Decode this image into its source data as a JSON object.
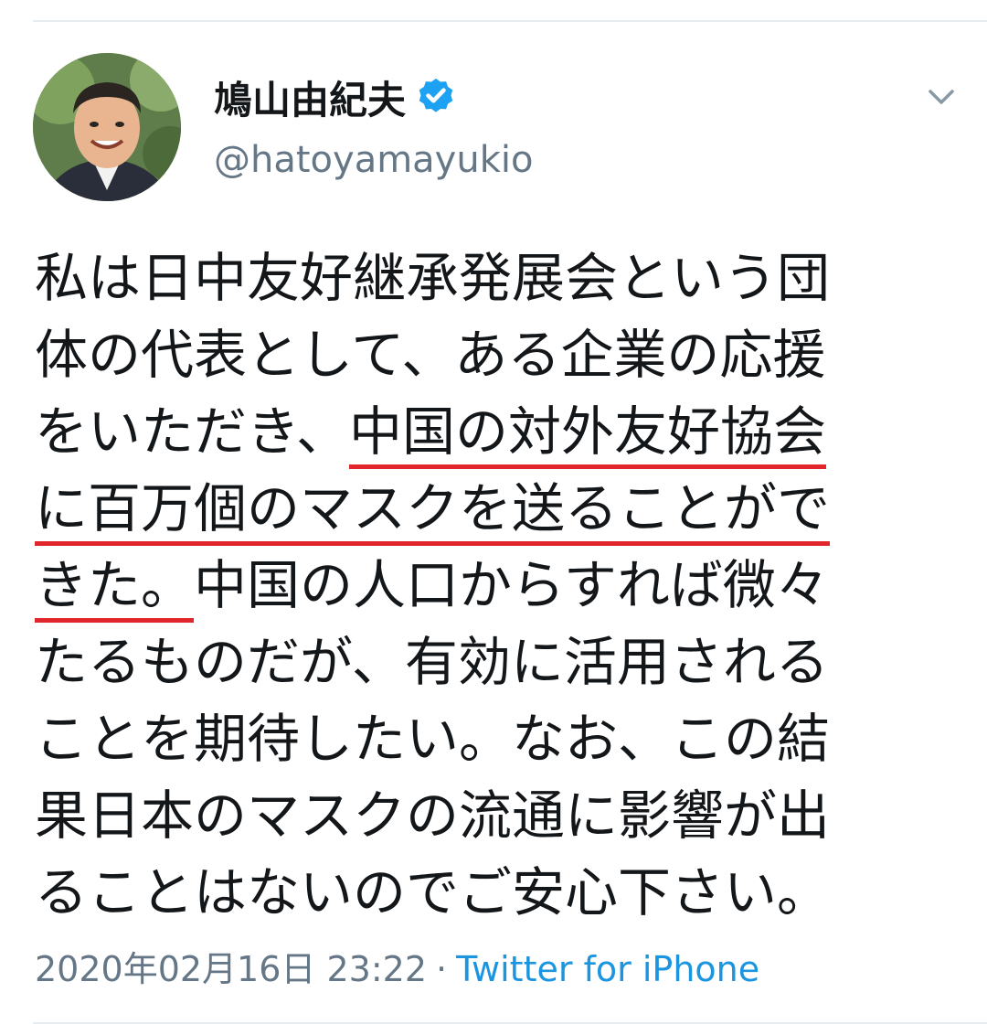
{
  "author": {
    "display_name": "鳩山由紀夫",
    "handle": "@hatoyamayukio",
    "verified": true
  },
  "tweet": {
    "lines": [
      {
        "plain": "私は日中友好継承発展会という団",
        "highlight": "",
        "rest": ""
      },
      {
        "plain": "体の代表として、ある企業の応援",
        "highlight": "",
        "rest": ""
      },
      {
        "plain": "をいただき、",
        "highlight": "中国の対外友好協会",
        "rest": ""
      },
      {
        "plain": "",
        "highlight": "に百万個のマスクを送ることがで",
        "rest": ""
      },
      {
        "plain": "",
        "highlight": "きた。",
        "rest": "中国の人口からすれば微々"
      },
      {
        "plain": "たるものだが、有効に活用される",
        "highlight": "",
        "rest": ""
      },
      {
        "plain": "ことを期待したい。なお、この結",
        "highlight": "",
        "rest": ""
      },
      {
        "plain": "果日本のマスクの流通に影響が出",
        "highlight": "",
        "rest": ""
      },
      {
        "plain": "ることはないのでご安心下さい。",
        "highlight": "",
        "rest": ""
      }
    ]
  },
  "meta": {
    "timestamp": "2020年02月16日 23:22",
    "separator": "·",
    "source": "Twitter for iPhone"
  },
  "icons": {
    "verified": "verified-badge-icon",
    "menu": "chevron-down-icon"
  },
  "colors": {
    "verified_blue": "#1da1f2",
    "link_blue": "#1b95e0",
    "highlight_underline": "#e0262a",
    "secondary_text": "#657786"
  }
}
